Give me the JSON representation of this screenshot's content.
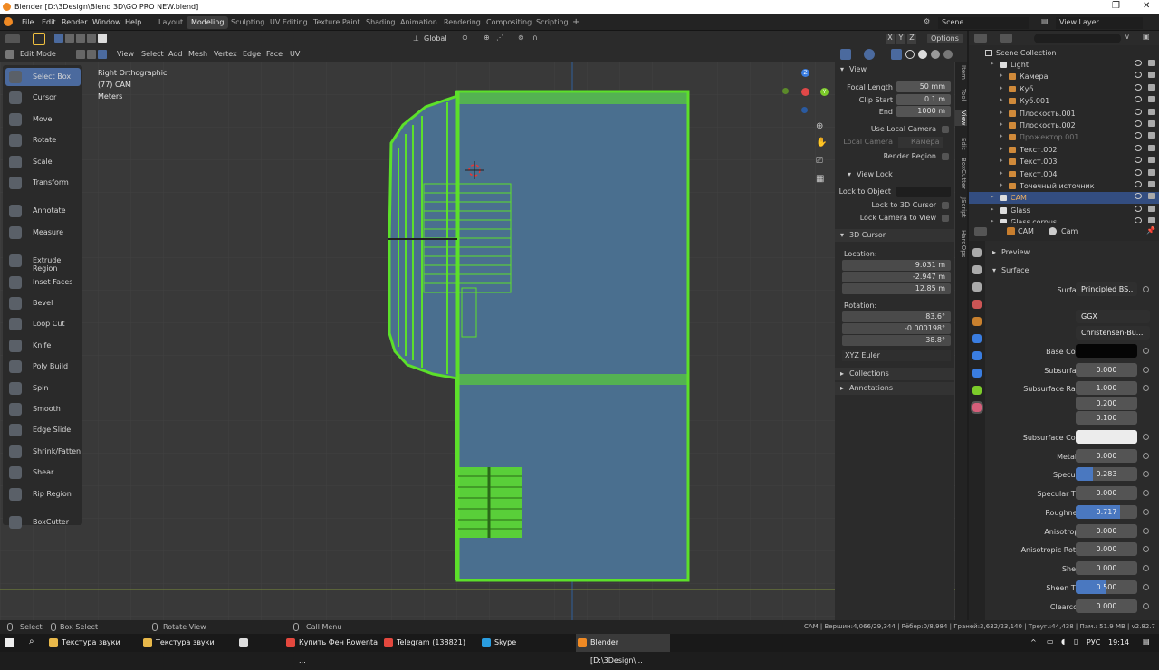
{
  "window": {
    "title": "Blender [D:\\3Design\\Blend 3D\\GO PRO NEW.blend]"
  },
  "menu": {
    "items": [
      "File",
      "Edit",
      "Render",
      "Window",
      "Help"
    ]
  },
  "workspaces": [
    {
      "label": "Layout"
    },
    {
      "label": "Modeling",
      "active": true
    },
    {
      "label": "Sculpting"
    },
    {
      "label": "UV Editing"
    },
    {
      "label": "Texture Paint"
    },
    {
      "label": "Shading"
    },
    {
      "label": "Animation"
    },
    {
      "label": "Rendering"
    },
    {
      "label": "Compositing"
    },
    {
      "label": "Scripting"
    }
  ],
  "scene": {
    "name": "Scene",
    "view_layer": "View Layer"
  },
  "header": {
    "transform": "Global",
    "options": "Options",
    "axes": [
      "X",
      "Y",
      "Z"
    ]
  },
  "viewport_header": {
    "mode": "Edit Mode",
    "menus": [
      "View",
      "Select",
      "Add",
      "Mesh",
      "Vertex",
      "Edge",
      "Face",
      "UV"
    ]
  },
  "viewport": {
    "view_name": "Right Orthographic",
    "object": "(77) CAM",
    "units": "Meters"
  },
  "gizmo": {
    "z": "Z",
    "y": "Y"
  },
  "tools": [
    {
      "label": "Select Box",
      "icon": "select-box-icon",
      "active": true
    },
    {
      "label": "Cursor",
      "icon": "cursor-icon"
    },
    {
      "label": "Move",
      "icon": "move-icon"
    },
    {
      "label": "Rotate",
      "icon": "rotate-icon"
    },
    {
      "label": "Scale",
      "icon": "scale-icon"
    },
    {
      "label": "Transform",
      "icon": "transform-icon"
    },
    {
      "label": "Annotate",
      "icon": "annotate-icon"
    },
    {
      "label": "Measure",
      "icon": "measure-icon"
    },
    {
      "label": "Extrude Region",
      "icon": "extrude-region-icon"
    },
    {
      "label": "Inset Faces",
      "icon": "inset-faces-icon"
    },
    {
      "label": "Bevel",
      "icon": "bevel-icon"
    },
    {
      "label": "Loop Cut",
      "icon": "loop-cut-icon"
    },
    {
      "label": "Knife",
      "icon": "knife-icon"
    },
    {
      "label": "Poly Build",
      "icon": "poly-build-icon"
    },
    {
      "label": "Spin",
      "icon": "spin-icon"
    },
    {
      "label": "Smooth",
      "icon": "smooth-icon"
    },
    {
      "label": "Edge Slide",
      "icon": "edge-slide-icon"
    },
    {
      "label": "Shrink/Fatten",
      "icon": "shrink-fatten-icon"
    },
    {
      "label": "Shear",
      "icon": "shear-icon"
    },
    {
      "label": "Rip Region",
      "icon": "rip-region-icon"
    },
    {
      "label": "BoxCutter",
      "icon": "boxcutter-icon"
    }
  ],
  "npanel": {
    "view_title": "View",
    "focal_length_label": "Focal Length",
    "focal_length": "50 mm",
    "clip_start_label": "Clip Start",
    "clip_start": "0.1 m",
    "end_label": "End",
    "end": "1000 m",
    "use_local_camera": "Use Local Camera",
    "local_camera_label": "Local Camera",
    "local_camera_value": "Камера",
    "render_region": "Render Region",
    "view_lock_title": "View Lock",
    "lock_to_object": "Lock to Object",
    "lock_to_3d_cursor": "Lock to 3D Cursor",
    "lock_camera_to_view": "Lock Camera to View",
    "cursor_title": "3D Cursor",
    "location_label": "Location:",
    "loc_x": "9.031 m",
    "loc_y": "-2.947 m",
    "loc_z": "12.85 m",
    "rotation_label": "Rotation:",
    "rot_x": "83.6°",
    "rot_y": "-0.000198°",
    "rot_z": "38.8°",
    "rotation_mode": "XYZ Euler",
    "collections": "Collections",
    "annotations": "Annotations",
    "axis_x": "X",
    "axis_y": "Y",
    "axis_z": "Z"
  },
  "ntabs": [
    "Item",
    "Tool",
    "View",
    "Edit",
    "BoxCutter",
    "JScript",
    "HardOps"
  ],
  "outliner": {
    "root": "Scene Collection",
    "items": [
      {
        "name": "Light",
        "indent": 1
      },
      {
        "name": "Камера",
        "indent": 2
      },
      {
        "name": "Куб",
        "indent": 2
      },
      {
        "name": "Куб.001",
        "indent": 2
      },
      {
        "name": "Плоскость.001",
        "indent": 2
      },
      {
        "name": "Плоскость.002",
        "indent": 2
      },
      {
        "name": "Прожектор.001",
        "indent": 2,
        "dim": true
      },
      {
        "name": "Текст.002",
        "indent": 2
      },
      {
        "name": "Текст.003",
        "indent": 2
      },
      {
        "name": "Текст.004",
        "indent": 2
      },
      {
        "name": "Точечный источник",
        "indent": 2
      },
      {
        "name": "CAM",
        "indent": 1,
        "selected": true
      },
      {
        "name": "Glass",
        "indent": 1
      },
      {
        "name": "Glass corpus",
        "indent": 1
      }
    ]
  },
  "properties": {
    "object": "CAM",
    "material": "Cam",
    "preview": "Preview",
    "surface_panel": "Surface",
    "rows": [
      {
        "label": "Surface",
        "value": "Principled BS..",
        "kind": "text"
      },
      {
        "label": "",
        "value": "GGX",
        "kind": "dropdown"
      },
      {
        "label": "",
        "value": "Christensen-Bu...",
        "kind": "dropdown"
      },
      {
        "label": "Base Color",
        "value": "",
        "kind": "color",
        "color": "#050505"
      },
      {
        "label": "Subsurface",
        "value": "0.000",
        "kind": "num"
      },
      {
        "label": "Subsurface Rad..",
        "value": "1.000",
        "kind": "num"
      },
      {
        "label": "",
        "value": "0.200",
        "kind": "num"
      },
      {
        "label": "",
        "value": "0.100",
        "kind": "num"
      },
      {
        "label": "Subsurface Color",
        "value": "",
        "kind": "color",
        "color": "#ececec"
      },
      {
        "label": "Metallic",
        "value": "0.000",
        "kind": "num"
      },
      {
        "label": "Specular",
        "value": "0.283",
        "kind": "slider",
        "fill": 0.283
      },
      {
        "label": "Specular Tint",
        "value": "0.000",
        "kind": "num"
      },
      {
        "label": "Roughness",
        "value": "0.717",
        "kind": "slider",
        "fill": 0.717
      },
      {
        "label": "Anisotropic",
        "value": "0.000",
        "kind": "num"
      },
      {
        "label": "Anisotropic Rota..",
        "value": "0.000",
        "kind": "num"
      },
      {
        "label": "Sheen",
        "value": "0.000",
        "kind": "num"
      },
      {
        "label": "Sheen Tint",
        "value": "0.500",
        "kind": "slider",
        "fill": 0.5
      },
      {
        "label": "Clearcoat",
        "value": "0.000",
        "kind": "num"
      }
    ]
  },
  "status": {
    "select": "Select",
    "box_select": "Box Select",
    "rotate_view": "Rotate View",
    "call_menu": "Call Menu",
    "stats": "CAM | Вершин:4,066/29,344 | Рёбер:0/8,984 | Граней:3,632/23,140 | Треуг.:44,438 | Пам.: 51.9 MB | v2.82.7"
  },
  "taskbar": {
    "tasks": [
      {
        "label": "Текстура звуки",
        "color": "#e8b84a"
      },
      {
        "label": "Текстура звуки",
        "color": "#e8b84a"
      },
      {
        "label": "",
        "color": "#dddddd"
      },
      {
        "label": "Купить Фен Rowenta ...",
        "color": "#e4483e"
      },
      {
        "label": "Telegram (138821)",
        "color": "#e4483e"
      },
      {
        "label": "Skype",
        "color": "#2a9de0"
      },
      {
        "label": "Blender [D:\\3Design\\...",
        "color": "#f08a24",
        "active": true
      }
    ],
    "lang": "РУС",
    "time": "19:14"
  },
  "colors": {
    "accent": "#4b6a9e",
    "mesh_fill": "#4a6f8f",
    "mesh_wire": "#5ce02a",
    "slider": "#4a78c0"
  }
}
